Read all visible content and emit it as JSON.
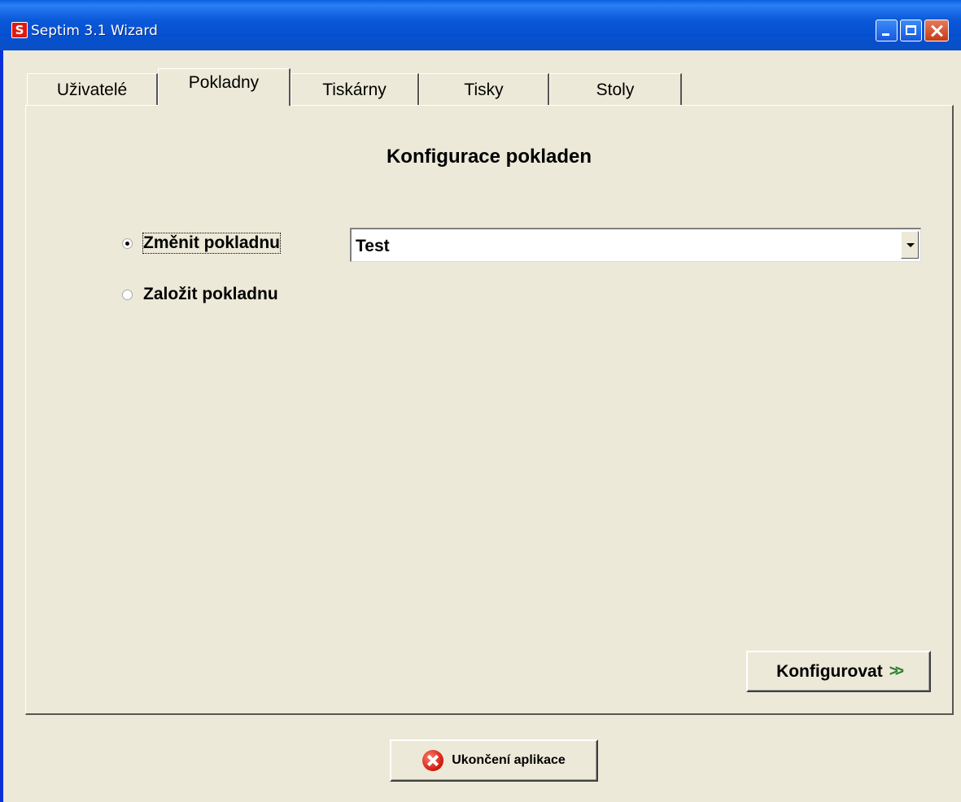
{
  "window": {
    "title": "Septim 3.1 Wizard",
    "app_icon_letter": "S"
  },
  "tabs": [
    {
      "label": "Uživatelé",
      "active": false
    },
    {
      "label": "Pokladny",
      "active": true
    },
    {
      "label": "Tiskárny",
      "active": false
    },
    {
      "label": "Tisky",
      "active": false
    },
    {
      "label": "Stoly",
      "active": false
    }
  ],
  "panel": {
    "title": "Konfigurace pokladen",
    "options": [
      {
        "label": "Změnit pokladnu",
        "checked": true
      },
      {
        "label": "Založit pokladnu",
        "checked": false
      }
    ],
    "select": {
      "value": "Test"
    },
    "configure_button": {
      "label": "Konfigurovat",
      "icon": "double-chevron-right-icon"
    }
  },
  "footer": {
    "exit_button": {
      "label": "Ukončení aplikace",
      "icon": "close-circle-icon"
    }
  }
}
